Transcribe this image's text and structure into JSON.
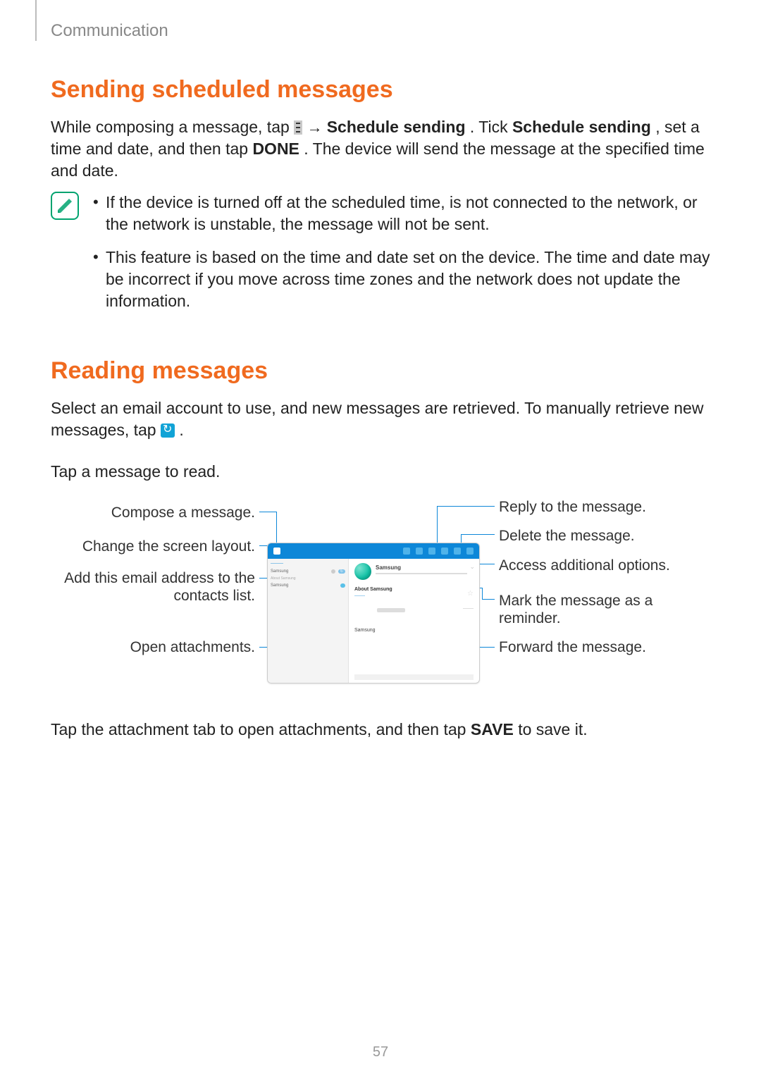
{
  "header": {
    "chapter": "Communication"
  },
  "section1": {
    "title": "Sending scheduled messages",
    "p1a": "While composing a message, tap ",
    "p1b": " → ",
    "p1c": "Schedule sending",
    "p1d": ". Tick ",
    "p1e": "Schedule sending",
    "p1f": ", set a time and date, and then tap ",
    "p1g": "DONE",
    "p1h": ". The device will send the message at the specified time and date.",
    "note1": "If the device is turned off at the scheduled time, is not connected to the network, or the network is unstable, the message will not be sent.",
    "note2": "This feature is based on the time and date set on the device. The time and date may be incorrect if you move across time zones and the network does not update the information."
  },
  "section2": {
    "title": "Reading messages",
    "p1a": "Select an email account to use, and new messages are retrieved. To manually retrieve new messages, tap ",
    "p1b": ".",
    "p2": "Tap a message to read."
  },
  "callouts": {
    "compose": "Compose a message.",
    "layout": "Change the screen layout.",
    "addcontact": "Add this email address to the contacts list.",
    "attachments": "Open attachments.",
    "reply": "Reply to the message.",
    "delete": "Delete the message.",
    "options": "Access additional options.",
    "reminder": "Mark the message as a reminder.",
    "forward": "Forward the message."
  },
  "screenshot": {
    "from": "Samsung",
    "subject": "About Samsung",
    "bodyname": "Samsung",
    "sidebar_name": "Samsung",
    "sidebar_sub": "About Samsung"
  },
  "after": {
    "p1a": "Tap the attachment tab to open attachments, and then tap ",
    "p1b": "SAVE",
    "p1c": " to save it."
  },
  "page_number": "57"
}
